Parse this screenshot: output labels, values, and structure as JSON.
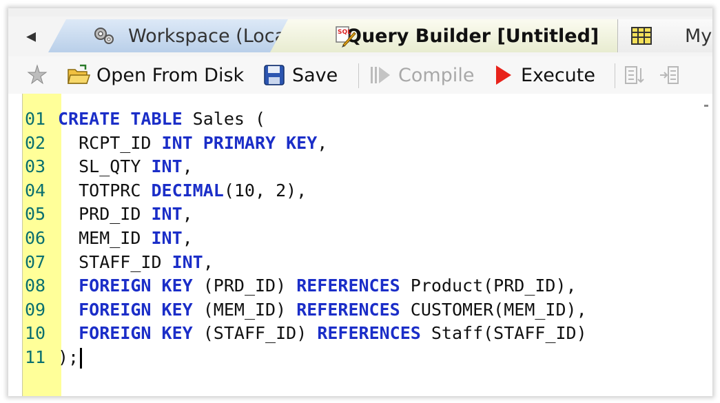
{
  "tabs": {
    "scroll_left": "◂",
    "items": [
      {
        "label": "Workspace (Local)",
        "icon": "workspace-gears-icon",
        "active": false
      },
      {
        "label": "Query Builder [Untitled]",
        "icon": "query-builder-icon",
        "active": true
      },
      {
        "label": "MyS",
        "icon": "table-grid-icon",
        "active": false
      }
    ]
  },
  "toolbar": {
    "open_label": "Open From Disk",
    "save_label": "Save",
    "compile_label": "Compile",
    "execute_label": "Execute"
  },
  "editor": {
    "lines": [
      {
        "n": "01",
        "segments": [
          {
            "t": "CREATE TABLE",
            "k": true
          },
          {
            "t": " Sales (",
            "k": false
          }
        ]
      },
      {
        "n": "02",
        "segments": [
          {
            "t": "  RCPT_ID ",
            "k": false
          },
          {
            "t": "INT PRIMARY KEY",
            "k": true
          },
          {
            "t": ",",
            "k": false
          }
        ]
      },
      {
        "n": "03",
        "segments": [
          {
            "t": "  SL_QTY ",
            "k": false
          },
          {
            "t": "INT",
            "k": true
          },
          {
            "t": ",",
            "k": false
          }
        ]
      },
      {
        "n": "04",
        "segments": [
          {
            "t": "  TOTPRC ",
            "k": false
          },
          {
            "t": "DECIMAL",
            "k": true
          },
          {
            "t": "(10, 2),",
            "k": false
          }
        ]
      },
      {
        "n": "05",
        "segments": [
          {
            "t": "  PRD_ID ",
            "k": false
          },
          {
            "t": "INT",
            "k": true
          },
          {
            "t": ",",
            "k": false
          }
        ]
      },
      {
        "n": "06",
        "segments": [
          {
            "t": "  MEM_ID ",
            "k": false
          },
          {
            "t": "INT",
            "k": true
          },
          {
            "t": ",",
            "k": false
          }
        ]
      },
      {
        "n": "07",
        "segments": [
          {
            "t": "  STAFF_ID ",
            "k": false
          },
          {
            "t": "INT",
            "k": true
          },
          {
            "t": ",",
            "k": false
          }
        ]
      },
      {
        "n": "08",
        "segments": [
          {
            "t": "  ",
            "k": false
          },
          {
            "t": "FOREIGN KEY",
            "k": true
          },
          {
            "t": " (PRD_ID) ",
            "k": false
          },
          {
            "t": "REFERENCES",
            "k": true
          },
          {
            "t": " Product(PRD_ID),",
            "k": false
          }
        ]
      },
      {
        "n": "09",
        "segments": [
          {
            "t": "  ",
            "k": false
          },
          {
            "t": "FOREIGN KEY",
            "k": true
          },
          {
            "t": " (MEM_ID) ",
            "k": false
          },
          {
            "t": "REFERENCES",
            "k": true
          },
          {
            "t": " CUSTOMER(MEM_ID),",
            "k": false
          }
        ]
      },
      {
        "n": "10",
        "segments": [
          {
            "t": "  ",
            "k": false
          },
          {
            "t": "FOREIGN KEY",
            "k": true
          },
          {
            "t": " (STAFF_ID) ",
            "k": false
          },
          {
            "t": "REFERENCES",
            "k": true
          },
          {
            "t": " Staff(STAFF_ID)",
            "k": false
          }
        ]
      },
      {
        "n": "11",
        "segments": [
          {
            "t": ");",
            "k": false
          }
        ]
      }
    ]
  },
  "colors": {
    "gutter": "#ffff99",
    "keyword": "#1b2ec8",
    "line_number": "#0a6f6f",
    "active_tab": "#e8ecd0",
    "workspace_tab": "#b9cfe9"
  }
}
